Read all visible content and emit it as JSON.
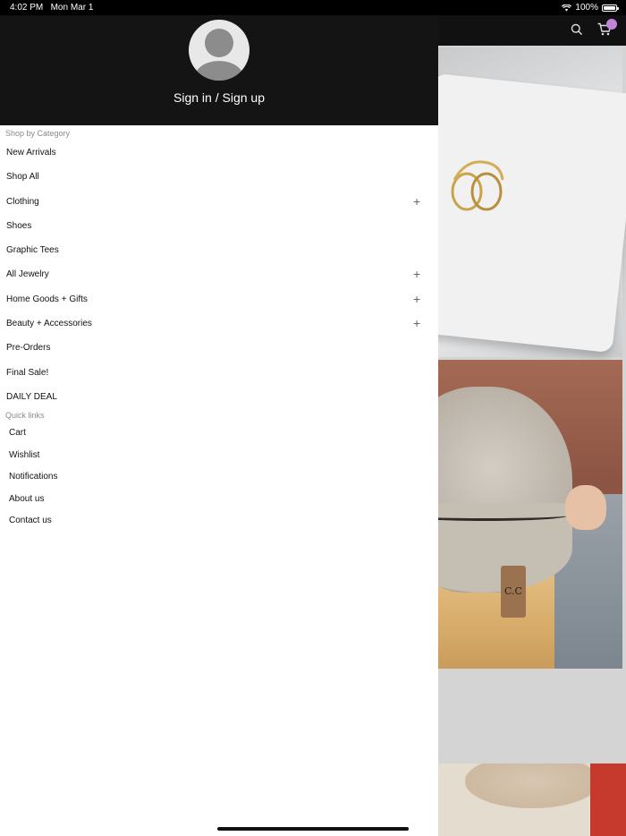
{
  "status_bar": {
    "time": "4:02 PM",
    "date": "Mon Mar 1",
    "battery": "100%",
    "battery_level": 1.0
  },
  "drawer": {
    "sign_in_label": "Sign in / Sign up",
    "categories_title": "Shop by Category",
    "categories": [
      {
        "label": "New Arrivals",
        "expandable": false
      },
      {
        "label": "Shop All",
        "expandable": false
      },
      {
        "label": "Clothing",
        "expandable": true
      },
      {
        "label": "Shoes",
        "expandable": false
      },
      {
        "label": "Graphic Tees",
        "expandable": false
      },
      {
        "label": "All Jewelry",
        "expandable": true
      },
      {
        "label": "Home Goods + Gifts",
        "expandable": true
      },
      {
        "label": "Beauty + Accessories",
        "expandable": true
      },
      {
        "label": "Pre-Orders",
        "expandable": false
      },
      {
        "label": "Final Sale!",
        "expandable": false
      },
      {
        "label": "DAILY DEAL",
        "expandable": false
      }
    ],
    "expand_symbol": "+",
    "quick_links_title": "Quick links",
    "quick_links": [
      "Cart",
      "Wishlist",
      "Notifications",
      "About us",
      "Contact us"
    ]
  },
  "background_app": {
    "header_icons": [
      "search-icon",
      "cart-icon"
    ],
    "cart_badge_color": "#c383d8",
    "products": [
      {
        "tag_text": ""
      },
      {
        "tag_text": "C.C"
      }
    ]
  },
  "colors": {
    "header_bg": "#141414",
    "drawer_bg": "#ffffff",
    "label_gray": "#8a8a8a"
  }
}
